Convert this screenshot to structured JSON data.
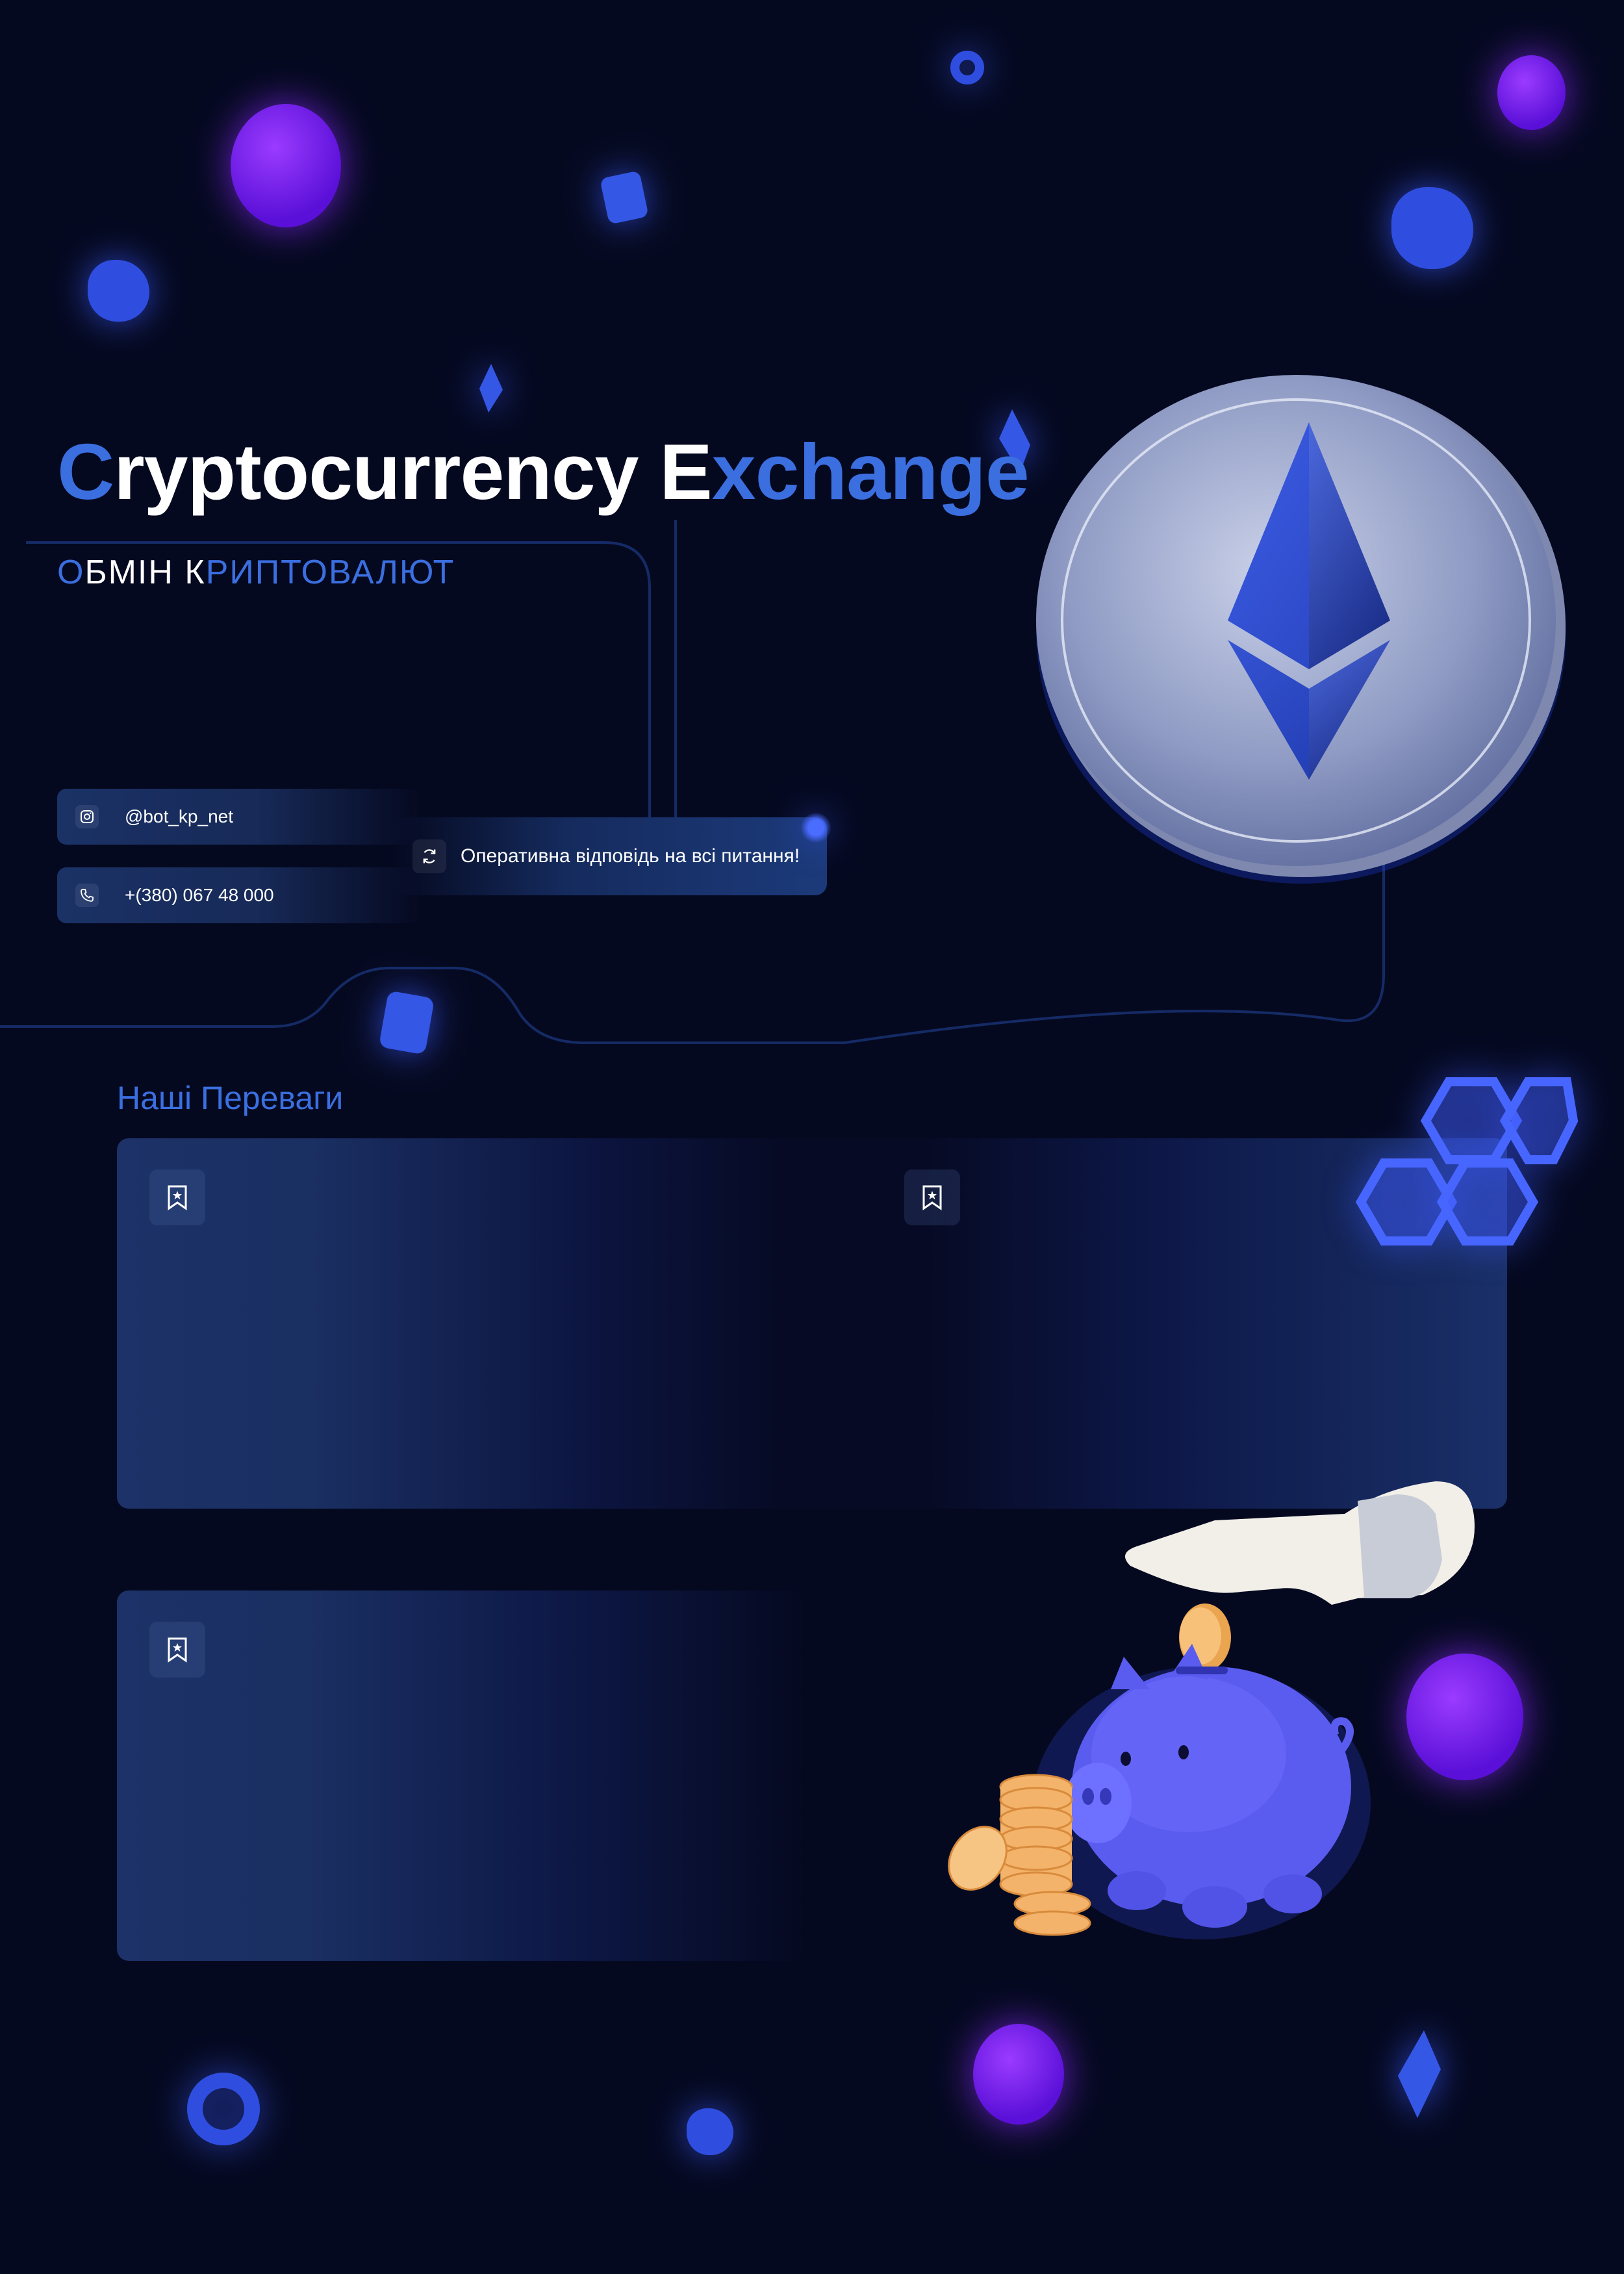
{
  "hero": {
    "title_parts": [
      "C",
      "ryptocurrency ",
      "E",
      "xchange"
    ],
    "subtitle_parts": [
      "О",
      "БМІН К",
      "РИПТОВАЛЮТ"
    ]
  },
  "contacts": {
    "instagram": {
      "icon": "instagram-icon",
      "label": "@bot_kp_net"
    },
    "phone": {
      "icon": "phone-icon",
      "label": "+(380) 067 48 000"
    },
    "support": {
      "icon": "refresh-icon",
      "label": "Оперативна відповідь на всі питання!"
    }
  },
  "advantages": {
    "title": "Наші Переваги",
    "cards": [
      {
        "icon": "bookmark-star-icon"
      },
      {
        "icon": "bookmark-star-icon"
      },
      {
        "icon": "bookmark-star-icon"
      }
    ]
  },
  "colors": {
    "background": "#050920",
    "accent": "#3b6fe0",
    "card": "#1a2f62",
    "glow_purple": "#8a2bff",
    "glow_blue": "#3d5cff"
  }
}
